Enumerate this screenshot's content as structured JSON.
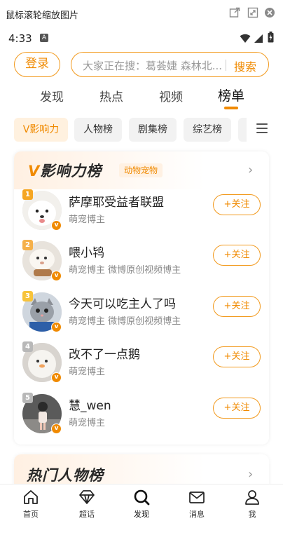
{
  "window": {
    "title": "鼠标滚轮缩放图片"
  },
  "status": {
    "time": "4:33",
    "notification": "A"
  },
  "top": {
    "login": "登录",
    "search_placeholder": "大家正在搜：葛荟婕 森林北...",
    "search_button": "搜索"
  },
  "main_tabs": [
    {
      "label": "发现"
    },
    {
      "label": "热点"
    },
    {
      "label": "视频"
    },
    {
      "label": "榜单",
      "active": true
    }
  ],
  "chips": [
    {
      "label": "V影响力",
      "active": true
    },
    {
      "label": "人物榜"
    },
    {
      "label": "剧集榜"
    },
    {
      "label": "综艺榜"
    }
  ],
  "card": {
    "title_v": "V",
    "title_rest": "影响力榜",
    "tag": "动物宠物",
    "follow_label": "+关注",
    "rows": [
      {
        "rank": "1",
        "name": "萨摩耶受益者联盟",
        "desc": "萌宠博主"
      },
      {
        "rank": "2",
        "name": "喂小鸨",
        "desc": "萌宠博主 微博原创视频博主"
      },
      {
        "rank": "3",
        "name": "今天可以吃主人了吗",
        "desc": "萌宠博主 微博原创视频博主"
      },
      {
        "rank": "4",
        "name": "改不了一点鹅",
        "desc": "萌宠博主"
      },
      {
        "rank": "5",
        "name": "慧_wen",
        "desc": "萌宠博主"
      }
    ]
  },
  "card2": {
    "title": "热门人物榜"
  },
  "bottom_nav": [
    {
      "label": "首页"
    },
    {
      "label": "超话"
    },
    {
      "label": "发现",
      "active": true
    },
    {
      "label": "消息"
    },
    {
      "label": "我"
    }
  ],
  "colors": {
    "accent": "#f08a00",
    "rank1": "#f5a623",
    "rank2": "#f5b04a",
    "rank3": "#f7c33a",
    "rank_other": "#b8b8b8"
  }
}
